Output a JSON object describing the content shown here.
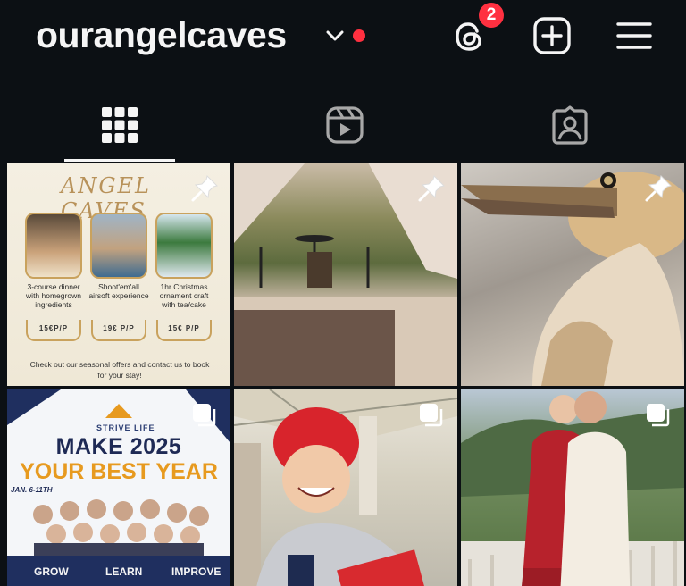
{
  "header": {
    "username": "ourangelcaves",
    "notification_count": "2",
    "accent_red": "#ff3040",
    "icons": [
      "chevron-down-icon",
      "threads-icon",
      "new-post-icon",
      "menu-icon"
    ]
  },
  "tabs": [
    {
      "name": "grid",
      "icon": "grid-icon",
      "active": true
    },
    {
      "name": "reels",
      "icon": "reels-icon",
      "active": false
    },
    {
      "name": "tagged",
      "icon": "tagged-icon",
      "active": false
    }
  ],
  "posts": {
    "p1": {
      "brand": "ANGEL CAVES",
      "items": [
        {
          "caption": "3-course dinner with homegrown ingredients",
          "price": "15€P/P"
        },
        {
          "caption": "Shoot'em'all airsoft experience",
          "price": "19€ P/P"
        },
        {
          "caption": "1hr Christmas ornament craft with tea/cake",
          "price": "15€ P/P"
        }
      ],
      "footer": "Check out our seasonal offers and contact us to book for your stay!"
    },
    "p4": {
      "brand": "STRIVE LIFE",
      "line1": "MAKE 2025",
      "line2": "YOUR BEST YEAR",
      "dates": "JAN. 6-11TH",
      "words": [
        "GROW",
        "LEARN",
        "IMPROVE"
      ]
    }
  }
}
